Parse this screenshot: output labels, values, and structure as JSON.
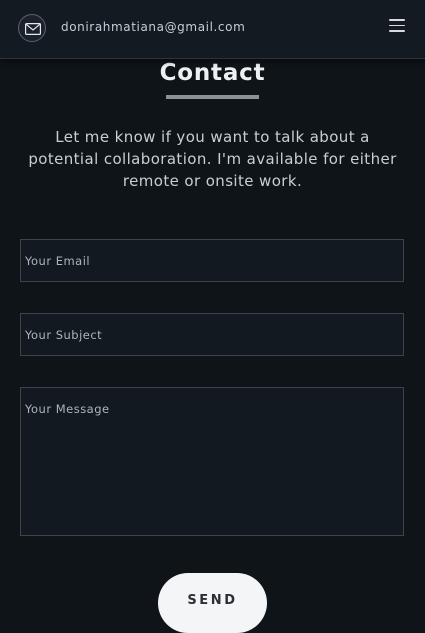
{
  "header": {
    "email": "donirahmatiana@gmail.com",
    "mail_icon": "envelope-icon",
    "menu_icon": "hamburger-menu-icon"
  },
  "contact": {
    "title": "Contact",
    "intro": "Let me know if you want to talk about a potential collaboration. I'm available for either remote or onsite work.",
    "email_placeholder": "Your Email",
    "subject_placeholder": "Your Subject",
    "message_placeholder": "Your Message",
    "send_label": "SEND"
  },
  "colors": {
    "background": "#0f1419",
    "header": "#141a22",
    "button": "#f4f5f6"
  }
}
